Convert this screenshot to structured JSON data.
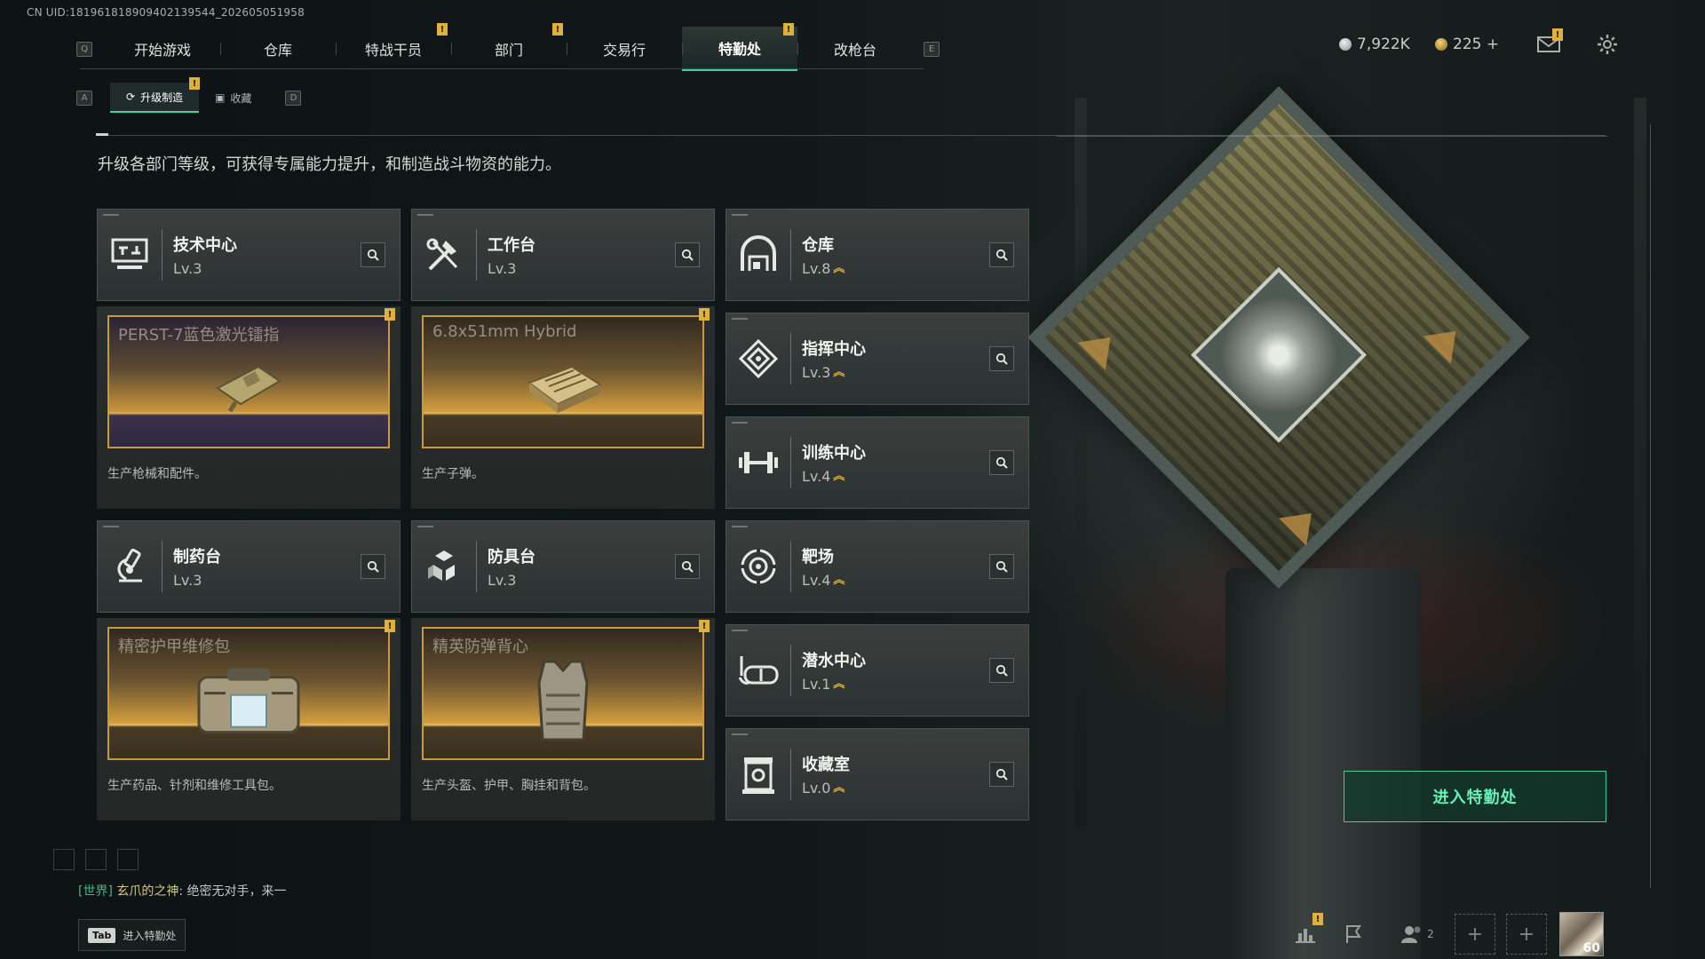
{
  "uid": "CN UID:1819618189094021395​44_202605051958",
  "nav": {
    "left_key": "Q",
    "right_key": "E",
    "tabs": [
      {
        "label": "开始游戏",
        "badge": ""
      },
      {
        "label": "仓库",
        "badge": ""
      },
      {
        "label": "特战干员",
        "badge": "!"
      },
      {
        "label": "部门",
        "badge": "!"
      },
      {
        "label": "交易行",
        "badge": ""
      },
      {
        "label": "特勤处",
        "badge": "!"
      },
      {
        "label": "改枪台",
        "badge": ""
      }
    ],
    "active_tab": "特勤处"
  },
  "currency": {
    "silver": "7,922K",
    "gold": "225 +"
  },
  "subtabs": {
    "left_key": "A",
    "right_key": "D",
    "items": [
      {
        "label": "升级制造",
        "badge": "!"
      },
      {
        "label": "收藏",
        "badge": ""
      }
    ]
  },
  "description": "升级各部门等级，可获得专属能力提升，和制造战斗物资的能力。",
  "departments_left": [
    {
      "name": "技术中心",
      "level": "Lv.3",
      "icon": "tech-center-icon",
      "product": "PERST-7蓝色激光镭指",
      "caption": "生产枪械和配件。",
      "badge": "!"
    },
    {
      "name": "工作台",
      "level": "Lv.3",
      "icon": "workbench-icon",
      "product": "6.8x51mm Hybrid",
      "caption": "生产子弹。",
      "badge": "!"
    },
    {
      "name": "制药台",
      "level": "Lv.3",
      "icon": "pharmacy-icon",
      "product": "精密护甲维修包",
      "caption": "生产药品、针剂和维修工具包。",
      "badge": "!"
    },
    {
      "name": "防具台",
      "level": "Lv.3",
      "icon": "armor-bench-icon",
      "product": "精英防弹背心",
      "caption": "生产头盔、护甲、胸挂和背包。",
      "badge": "!"
    }
  ],
  "departments_right": [
    {
      "name": "仓库",
      "level": "Lv.8",
      "icon": "warehouse-icon"
    },
    {
      "name": "指挥中心",
      "level": "Lv.3",
      "icon": "command-center-icon"
    },
    {
      "name": "训练中心",
      "level": "Lv.4",
      "icon": "training-center-icon"
    },
    {
      "name": "靶场",
      "level": "Lv.4",
      "icon": "shooting-range-icon"
    },
    {
      "name": "潜水中心",
      "level": "Lv.1",
      "icon": "diving-center-icon"
    },
    {
      "name": "收藏室",
      "level": "Lv.0",
      "icon": "collection-room-icon"
    }
  ],
  "enter_button": "进入特勤处",
  "chat": {
    "channel": "[世界]",
    "user": "玄爪的之神",
    "message": ": 绝密无对手，来一"
  },
  "tab_hint": {
    "key": "Tab",
    "label": "进入特勤处"
  },
  "bottom": {
    "friends_count": "2",
    "player_level": "60"
  },
  "colors": {
    "accent": "#3fd0a0",
    "badge": "#e0b13a",
    "product_border": "#c89a3a"
  }
}
